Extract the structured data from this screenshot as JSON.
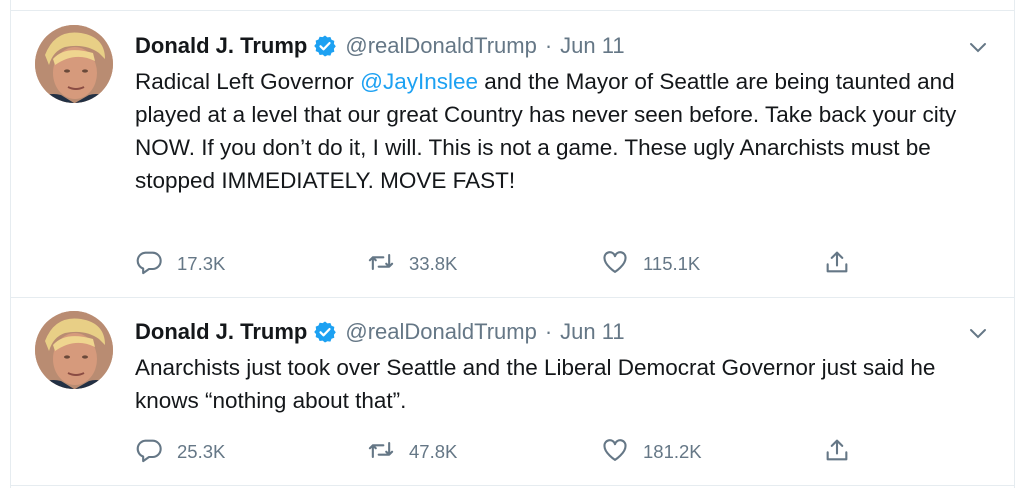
{
  "tweets": [
    {
      "author": {
        "name": "Donald J. Trump",
        "handle": "@realDonaldTrump",
        "verified": true
      },
      "separator": "·",
      "date": "Jun 11",
      "text_before": "Radical Left Governor ",
      "mention": "@JayInslee",
      "text_after": " and the Mayor of Seattle are being taunted and played at a level that our great Country has never seen before. Take back your city NOW. If you don’t do it, I will. This is not a game. These ugly Anarchists must be stopped IMMEDIATELY. MOVE FAST!",
      "counts": {
        "replies": "17.3K",
        "retweets": "33.8K",
        "likes": "115.1K"
      }
    },
    {
      "author": {
        "name": "Donald J. Trump",
        "handle": "@realDonaldTrump",
        "verified": true
      },
      "separator": "·",
      "date": "Jun 11",
      "text_before": "Anarchists just took over Seattle and the Liberal Democrat Governor just said he knows “nothing about that”.",
      "mention": "",
      "text_after": "",
      "counts": {
        "replies": "25.3K",
        "retweets": "47.8K",
        "likes": "181.2K"
      }
    }
  ],
  "icons": [
    "avatar",
    "verified-badge-icon",
    "chevron-down-icon",
    "reply-icon",
    "retweet-icon",
    "like-icon",
    "share-icon"
  ],
  "colors": {
    "link": "#1da1f2",
    "muted": "#657786",
    "text": "#14171a",
    "border": "#e6ecf0"
  }
}
